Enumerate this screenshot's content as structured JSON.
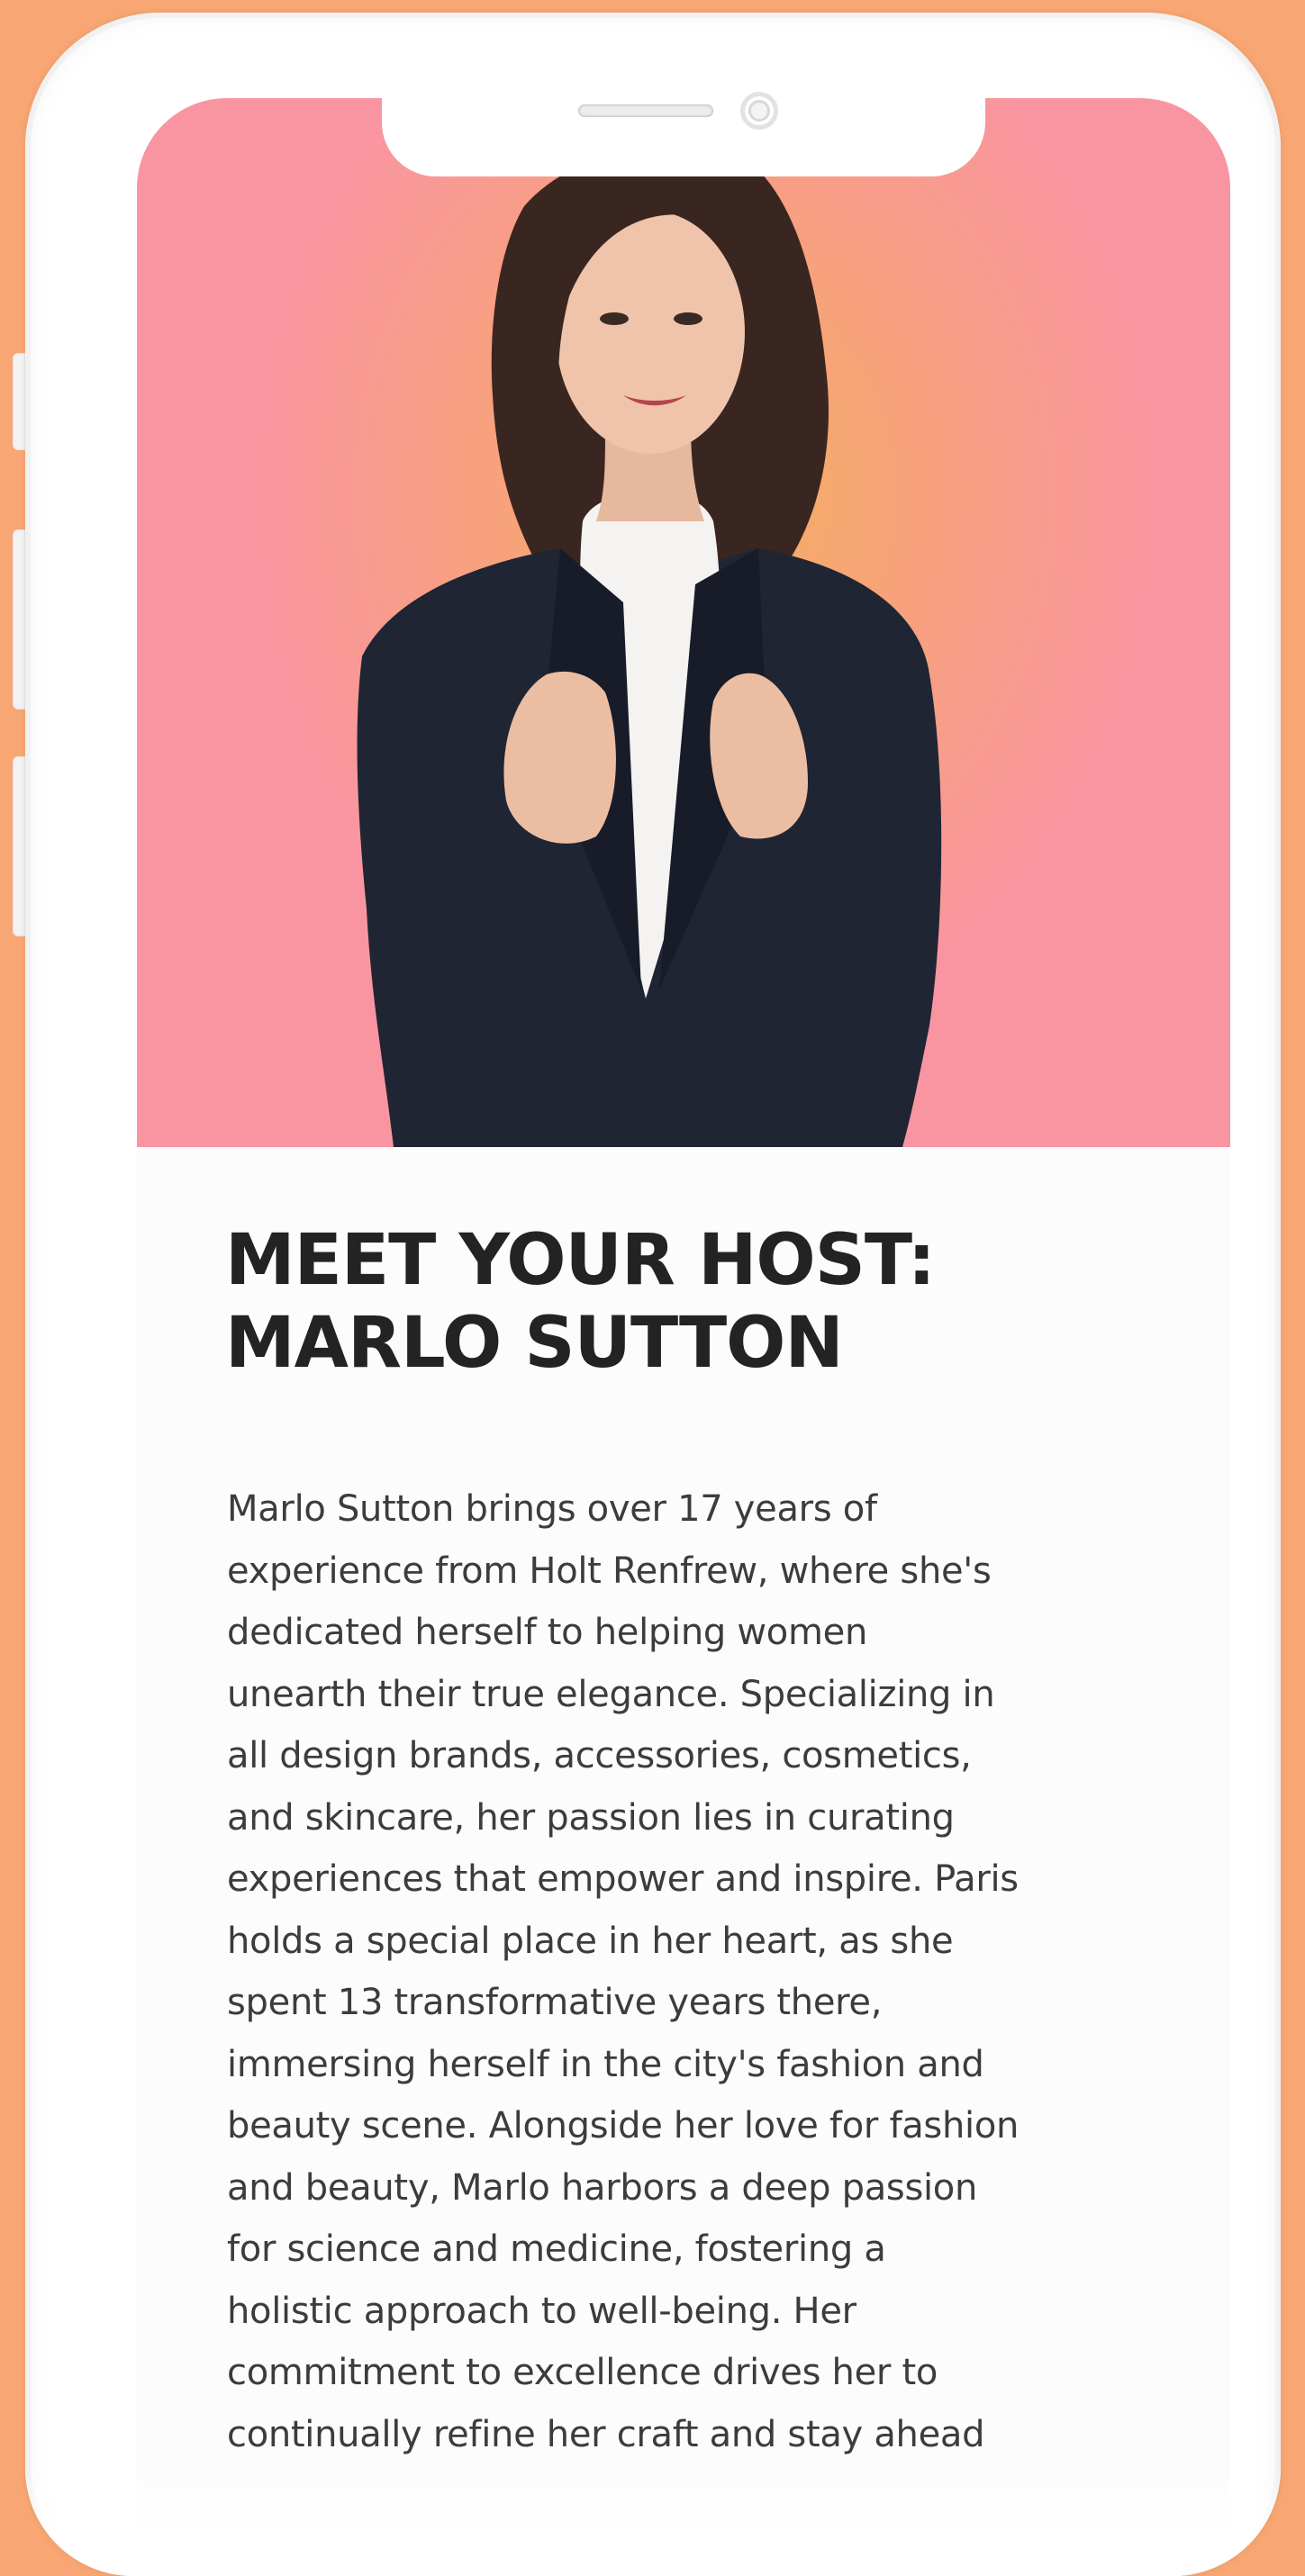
{
  "hero": {
    "photo_alt": "Portrait of Marlo Sutton in black blazer and white ruffled blouse"
  },
  "section": {
    "title_line1": "MEET YOUR HOST:",
    "title_line2": "MARLO SUTTON",
    "bio_lines": [
      "Marlo Sutton brings over 17 years of",
      "experience from Holt Renfrew, where she's",
      "dedicated herself to helping women",
      "unearth their true elegance. Specializing in",
      "all design brands, accessories, cosmetics,",
      "and skincare, her passion lies in curating",
      "experiences that empower and inspire. Paris",
      "holds a special place in her heart, as she",
      "spent 13 transformative years there,",
      "immersing herself in the city's fashion and",
      "beauty scene. Alongside her love for fashion",
      "and beauty, Marlo harbors a deep passion",
      "for science and medicine, fostering a",
      "holistic approach to well-being. Her",
      "commitment to excellence drives her to",
      "continually refine her craft and stay ahead"
    ]
  },
  "colors": {
    "page_background": "#f8a673",
    "hero_gradient_center": "#f5b05c",
    "hero_gradient_edge": "#f995a1",
    "title_text": "#232323",
    "body_text": "#3c3c3c"
  }
}
